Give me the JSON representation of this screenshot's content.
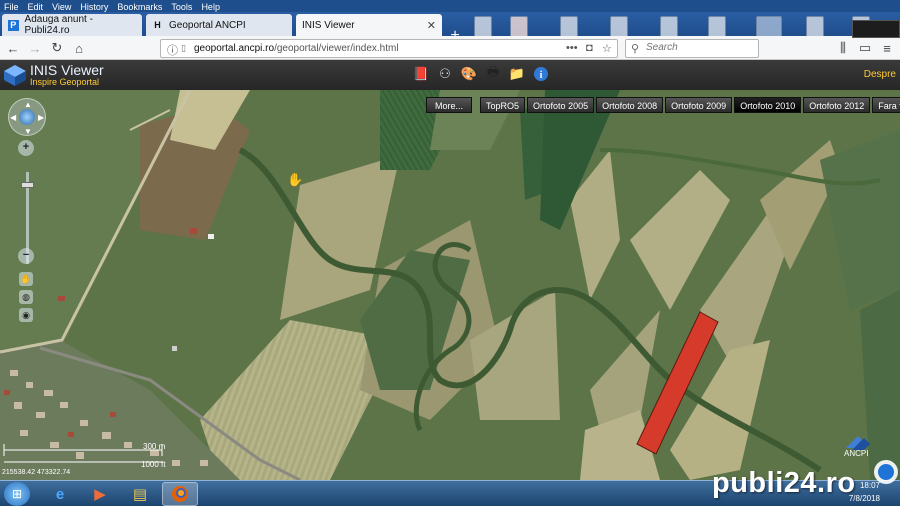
{
  "browser": {
    "menu": [
      "File",
      "Edit",
      "View",
      "History",
      "Bookmarks",
      "Tools",
      "Help"
    ],
    "tabs": [
      {
        "label": "Adauga anunt - Publi24.ro",
        "favicon": "P",
        "favicon_color": "#1e73d6"
      },
      {
        "label": "Geoportal ANCPI",
        "favicon": "H",
        "favicon_color": "#333333"
      },
      {
        "label": "INIS Viewer",
        "favicon": "",
        "favicon_color": "#2a6fb8"
      }
    ],
    "new_tab": "+",
    "url_host": "geoportal.ancpi.ro",
    "url_path": "/geoportal/viewer/index.html",
    "url_dots": "•••",
    "search_placeholder": "Search"
  },
  "inis": {
    "title": "INIS Viewer",
    "subtitle": "Inspire Geoportal",
    "despre": "Despre",
    "tools": [
      "book-icon",
      "binoculars-icon",
      "palette-icon",
      "printer-icon",
      "folder-icon",
      "info-icon"
    ]
  },
  "map": {
    "more_label": "More...",
    "basemaps": [
      "TopRO5",
      "Ortofoto 2005",
      "Ortofoto 2008",
      "Ortofoto 2009",
      "Ortofoto 2010",
      "Ortofoto 2012",
      "Fara fundal"
    ],
    "selected_basemap": "Ortofoto 2010",
    "scale_top": "300 m",
    "scale_bottom": "1000 ft",
    "coords": "215538.42 473322.74",
    "ancpi_label": "ANCPI",
    "parcel_color": "#d63a2a"
  },
  "taskbar": {
    "time": "18:07",
    "date": "7/8/2018"
  },
  "watermark": {
    "text": "publi24.ro"
  }
}
